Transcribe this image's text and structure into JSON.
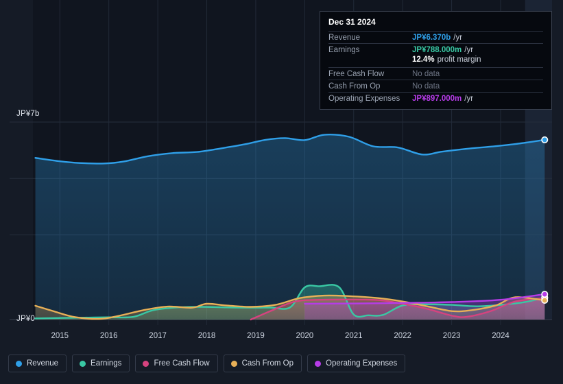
{
  "chart_data": {
    "type": "area",
    "title": "",
    "xlabel": "",
    "ylabel": "",
    "currency": "JP¥",
    "grid": true,
    "legend_position": "bottom-left",
    "ylim": [
      0,
      7
    ],
    "y_ticks": [
      {
        "label": "JP¥7b",
        "value": 7
      },
      {
        "label": "JP¥0",
        "value": 0
      }
    ],
    "x_ticks": [
      "2015",
      "2016",
      "2017",
      "2018",
      "2019",
      "2020",
      "2021",
      "2022",
      "2023",
      "2024"
    ],
    "x_range": [
      "2014-06",
      "2025-03"
    ],
    "series": [
      {
        "name": "Revenue",
        "color": "#2f9fe8",
        "unit": "b",
        "x": [
          2014.5,
          2015.0,
          2015.4,
          2015.9,
          2016.3,
          2016.8,
          2017.3,
          2017.8,
          2018.3,
          2018.8,
          2019.2,
          2019.6,
          2020.0,
          2020.4,
          2020.9,
          2021.4,
          2021.9,
          2022.4,
          2022.8,
          2023.3,
          2023.8,
          2024.3,
          2024.9
        ],
        "values": [
          5.73,
          5.61,
          5.55,
          5.53,
          5.6,
          5.79,
          5.9,
          5.94,
          6.07,
          6.22,
          6.37,
          6.43,
          6.36,
          6.55,
          6.48,
          6.14,
          6.1,
          5.85,
          5.95,
          6.05,
          6.13,
          6.22,
          6.37
        ]
      },
      {
        "name": "Earnings",
        "color": "#39c8a4",
        "unit": "m",
        "x": [
          2014.5,
          2015.0,
          2015.5,
          2016.0,
          2016.5,
          2016.9,
          2017.4,
          2017.9,
          2018.4,
          2018.9,
          2019.3,
          2019.7,
          2020.0,
          2020.3,
          2020.7,
          2021.0,
          2021.3,
          2021.6,
          2022.0,
          2022.5,
          2023.0,
          2023.5,
          2024.0,
          2024.5,
          2024.9
        ],
        "values": [
          40,
          55,
          68,
          80,
          95,
          330,
          430,
          450,
          430,
          420,
          425,
          430,
          1140,
          1180,
          1150,
          180,
          150,
          165,
          500,
          540,
          520,
          470,
          520,
          620,
          788
        ]
      },
      {
        "name": "Free Cash Flow",
        "color": "#d6437f",
        "unit": "m",
        "x": [
          2018.9,
          2019.3,
          2019.8,
          2020.3,
          2020.9,
          2021.5,
          2022.0,
          2022.5,
          2023.0,
          2023.3,
          2023.8,
          2024.3,
          2024.9
        ],
        "values": [
          0,
          300,
          640,
          700,
          710,
          690,
          560,
          380,
          140,
          95,
          300,
          640,
          760
        ]
      },
      {
        "name": "Cash From Op",
        "color": "#e8b057",
        "unit": "m",
        "x": [
          2014.5,
          2014.9,
          2015.3,
          2015.8,
          2016.2,
          2016.7,
          2017.2,
          2017.7,
          2018.0,
          2018.4,
          2018.9,
          2019.4,
          2019.9,
          2020.4,
          2020.9,
          2021.5,
          2022.0,
          2022.5,
          2023.0,
          2023.4,
          2023.9,
          2024.3,
          2024.9
        ],
        "values": [
          490,
          280,
          90,
          20,
          130,
          330,
          460,
          420,
          560,
          500,
          450,
          520,
          760,
          850,
          830,
          760,
          640,
          470,
          300,
          330,
          500,
          790,
          680
        ]
      },
      {
        "name": "Operating Expenses",
        "color": "#b63ce8",
        "unit": "m",
        "x": [
          2020.0,
          2021.0,
          2022.0,
          2023.0,
          2024.0,
          2024.9
        ],
        "values": [
          560,
          570,
          590,
          620,
          700,
          897
        ]
      }
    ]
  },
  "tooltip": {
    "date": "Dec 31 2024",
    "rows": [
      {
        "key": "Revenue",
        "value": "JP¥6.370b",
        "unit": "/yr",
        "style": "rev",
        "nodata": false
      },
      {
        "key": "Earnings",
        "value": "JP¥788.000m",
        "unit": "/yr",
        "style": "earn",
        "nodata": false
      },
      {
        "key": "",
        "value": "12.4%",
        "unit": "profit margin",
        "style": "margin",
        "nodata": false
      },
      {
        "key": "Free Cash Flow",
        "value": "No data",
        "unit": "",
        "style": "nodata",
        "nodata": true
      },
      {
        "key": "Cash From Op",
        "value": "No data",
        "unit": "",
        "style": "nodata",
        "nodata": true
      },
      {
        "key": "Operating Expenses",
        "value": "JP¥897.000m",
        "unit": "/yr",
        "style": "opex",
        "nodata": false
      }
    ]
  },
  "legend": {
    "items": [
      {
        "label": "Revenue",
        "color": "#2f9fe8"
      },
      {
        "label": "Earnings",
        "color": "#39c8a4"
      },
      {
        "label": "Free Cash Flow",
        "color": "#d6437f"
      },
      {
        "label": "Cash From Op",
        "color": "#e8b057"
      },
      {
        "label": "Operating Expenses",
        "color": "#b63ce8"
      }
    ]
  }
}
